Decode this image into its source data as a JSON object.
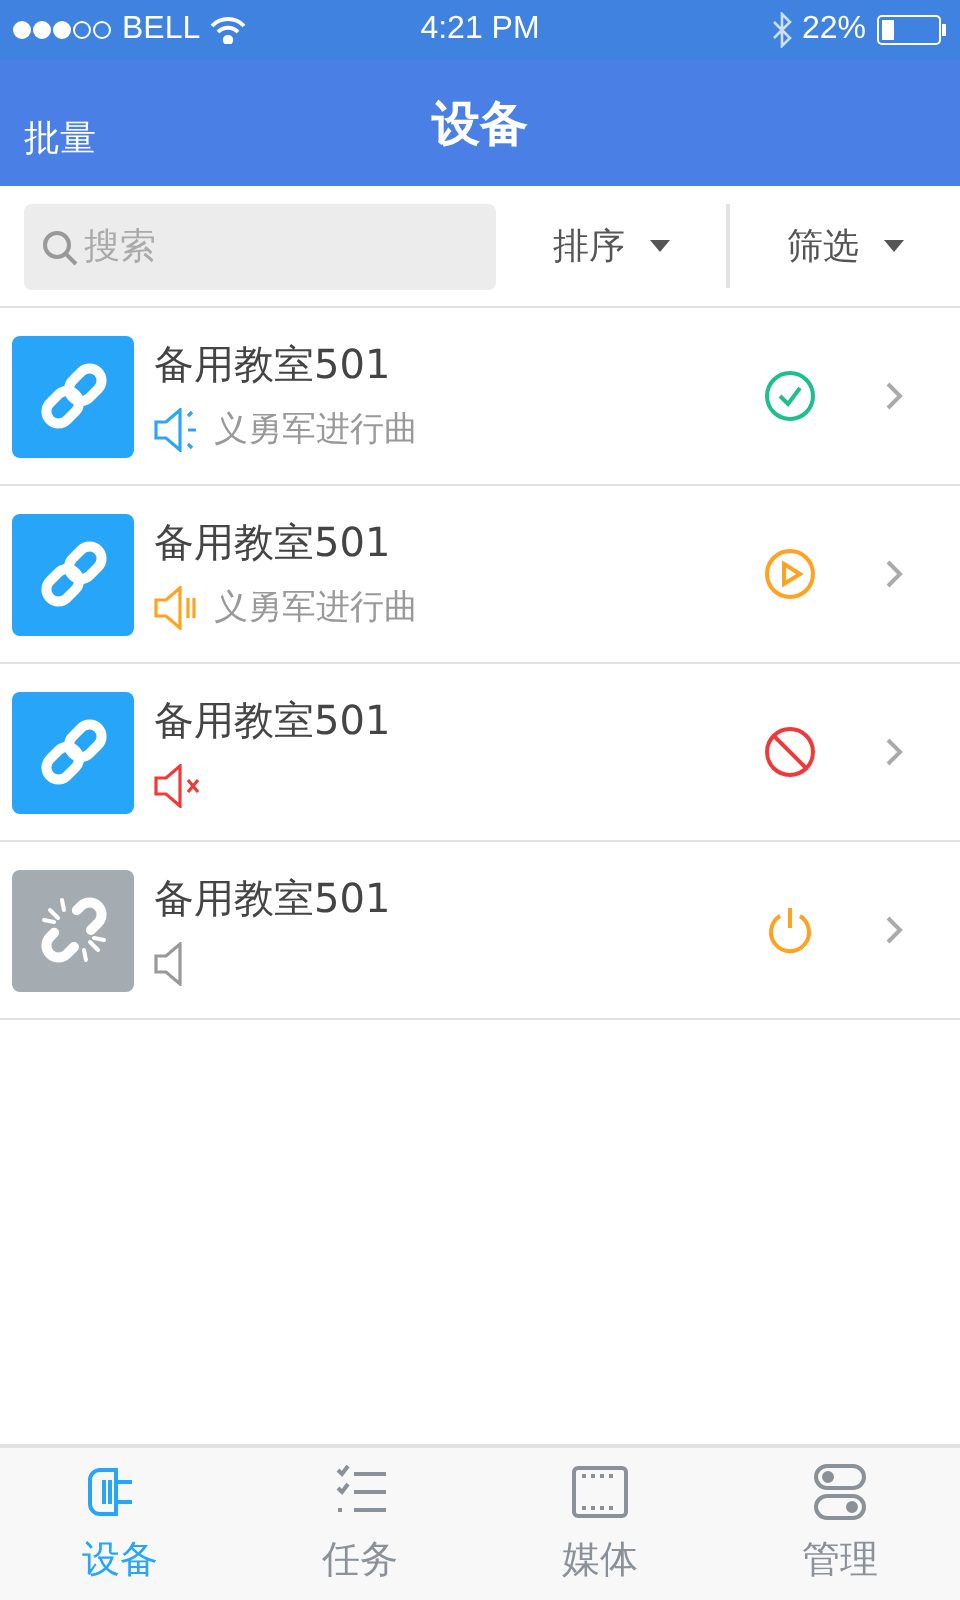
{
  "status_bar": {
    "carrier": "BELL",
    "time": "4:21 PM",
    "battery": "22%"
  },
  "nav": {
    "left": "批量",
    "title": "设备"
  },
  "toolbar": {
    "search": {
      "placeholder": "搜索"
    },
    "sort": "排序",
    "filter": "筛选"
  },
  "devices": [
    {
      "name": "备用教室501",
      "connected": true,
      "speaker": {
        "kind": "playing"
      },
      "song": "义勇军进行曲",
      "status": {
        "kind": "online"
      }
    },
    {
      "name": "备用教室501",
      "connected": true,
      "speaker": {
        "kind": "paused"
      },
      "song": "义勇军进行曲",
      "status": {
        "kind": "playing"
      }
    },
    {
      "name": "备用教室501",
      "connected": true,
      "speaker": {
        "kind": "muted"
      },
      "status": {
        "kind": "blocked"
      }
    },
    {
      "name": "备用教室501",
      "connected": false,
      "speaker": {
        "kind": "idle"
      },
      "status": {
        "kind": "off"
      }
    }
  ],
  "tabs": [
    {
      "label": "设备",
      "kind": "device",
      "selected": true
    },
    {
      "label": "任务",
      "kind": "tasks",
      "selected": false
    },
    {
      "label": "媒体",
      "kind": "media",
      "selected": false
    },
    {
      "label": "管理",
      "kind": "manage",
      "selected": false
    }
  ]
}
